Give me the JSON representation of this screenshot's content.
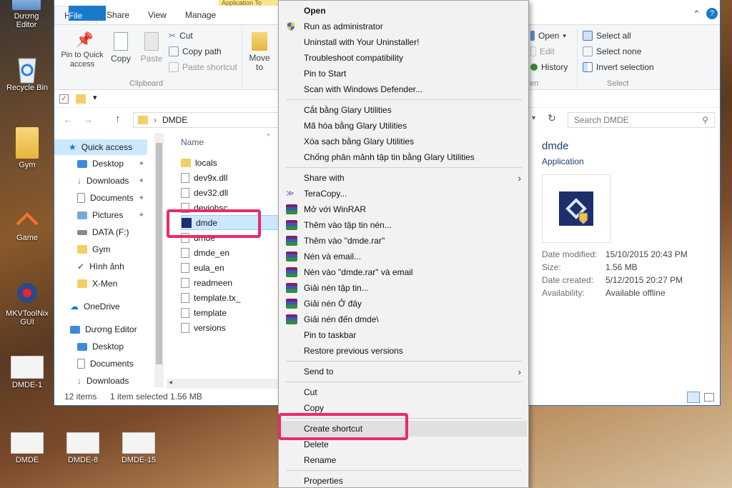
{
  "desktop": {
    "icons": [
      {
        "label": "Dương Editor"
      },
      {
        "label": "Recycle Bin"
      },
      {
        "label": "Gym"
      },
      {
        "label": "Game"
      },
      {
        "label": "MKVToolNix GUI"
      },
      {
        "label": "DMDE-1"
      },
      {
        "label": "DMDE"
      },
      {
        "label": "DMDE-8"
      },
      {
        "label": "DMDE-15"
      }
    ]
  },
  "explorer": {
    "tabs": {
      "file": "File",
      "home": "Home",
      "share": "Share",
      "view": "View",
      "manage": "Manage",
      "context": "Application To"
    },
    "ribbon": {
      "pin": "Pin to Quick access",
      "copy": "Copy",
      "paste": "Paste",
      "cut": "Cut",
      "copy_path": "Copy path",
      "paste_shortcut": "Paste shortcut",
      "clipboard_group": "Clipboard",
      "move_to": "Move to",
      "open": "Open",
      "edit": "Edit",
      "history": "History",
      "open_group": "en",
      "select_all": "Select all",
      "select_none": "Select none",
      "invert": "Invert selection",
      "select_group": "Select"
    },
    "address": {
      "path": "DMDE",
      "search_placeholder": "Search DMDE"
    },
    "nav": [
      {
        "label": "Quick access",
        "pinned": false
      },
      {
        "label": "Desktop",
        "pinned": true
      },
      {
        "label": "Downloads",
        "pinned": true
      },
      {
        "label": "Documents",
        "pinned": true
      },
      {
        "label": "Pictures",
        "pinned": true
      },
      {
        "label": "DATA (F:)",
        "pinned": false
      },
      {
        "label": "Gym",
        "pinned": false
      },
      {
        "label": "Hình ảnh",
        "pinned": false
      },
      {
        "label": "X-Men",
        "pinned": false
      },
      {
        "label": "OneDrive",
        "pinned": false
      },
      {
        "label": "Dương Editor",
        "pinned": false
      },
      {
        "label": "Desktop",
        "pinned": false
      },
      {
        "label": "Documents",
        "pinned": false
      },
      {
        "label": "Downloads",
        "pinned": false
      }
    ],
    "column_name": "Name",
    "files": [
      {
        "name": "locals",
        "icon": "folder-icon"
      },
      {
        "name": "dev9x.dll",
        "icon": "dll-icon"
      },
      {
        "name": "dev32.dll",
        "icon": "dll-icon"
      },
      {
        "name": "deviohsc",
        "icon": "file-icon"
      },
      {
        "name": "dmde",
        "icon": "app-icon"
      },
      {
        "name": "dmde",
        "icon": "file-icon"
      },
      {
        "name": "dmde_en",
        "icon": "settings-file-icon"
      },
      {
        "name": "eula_en",
        "icon": "text-file-icon"
      },
      {
        "name": "readmeen",
        "icon": "text-file-icon"
      },
      {
        "name": "template.tx_",
        "icon": "file-icon"
      },
      {
        "name": "template",
        "icon": "text-file-icon"
      },
      {
        "name": "versions",
        "icon": "text-file-icon"
      }
    ],
    "status": {
      "count": "12 items",
      "selection": "1 item selected  1.56 MB"
    },
    "preview": {
      "title": "dmde",
      "type": "Application",
      "props": [
        {
          "key": "Date modified:",
          "value": "15/10/2015 20:43 PM"
        },
        {
          "key": "Size:",
          "value": "1.56 MB"
        },
        {
          "key": "Date created:",
          "value": "5/12/2015 20:27 PM"
        },
        {
          "key": "Availability:",
          "value": "Available offline"
        }
      ]
    }
  },
  "context_menu": {
    "items": [
      {
        "label": "Open",
        "bold": true
      },
      {
        "label": "Run as administrator",
        "icon": "shield-icon"
      },
      {
        "label": "Uninstall with Your Uninstaller!"
      },
      {
        "label": "Troubleshoot compatibility"
      },
      {
        "label": "Pin to Start"
      },
      {
        "label": "Scan with Windows Defender..."
      },
      {
        "label": "Cắt bằng Glary Utilities"
      },
      {
        "label": "Mã hóa bằng Glary Utilities"
      },
      {
        "label": "Xóa sạch bằng Glary Utilities"
      },
      {
        "label": "Chống phân mảnh tập tin bằng Glary Utilities"
      },
      {
        "label": "Share with",
        "submenu": true
      },
      {
        "label": "TeraCopy...",
        "icon": "teracopy-icon"
      },
      {
        "label": "Mở với WinRAR",
        "icon": "winrar-icon"
      },
      {
        "label": "Thêm vào tập tin nén...",
        "icon": "winrar-icon"
      },
      {
        "label": "Thêm vào \"dmde.rar\"",
        "icon": "winrar-icon"
      },
      {
        "label": "Nén và email...",
        "icon": "winrar-icon"
      },
      {
        "label": "Nén vào \"dmde.rar\" và email",
        "icon": "winrar-icon"
      },
      {
        "label": "Giải nén tập tin...",
        "icon": "winrar-icon"
      },
      {
        "label": "Giải nén Ở đây",
        "icon": "winrar-icon"
      },
      {
        "label": "Giải nén đến dmde\\",
        "icon": "winrar-icon"
      },
      {
        "label": "Pin to taskbar"
      },
      {
        "label": "Restore previous versions"
      },
      {
        "label": "Send to",
        "submenu": true
      },
      {
        "label": "Cut"
      },
      {
        "label": "Copy"
      },
      {
        "label": "Create shortcut",
        "highlighted": true
      },
      {
        "label": "Delete"
      },
      {
        "label": "Rename"
      },
      {
        "label": "Properties"
      }
    ]
  },
  "colors": {
    "accent": "#1979ca",
    "highlight_box": "#ea2a6a",
    "selection": "#cce8ff"
  }
}
